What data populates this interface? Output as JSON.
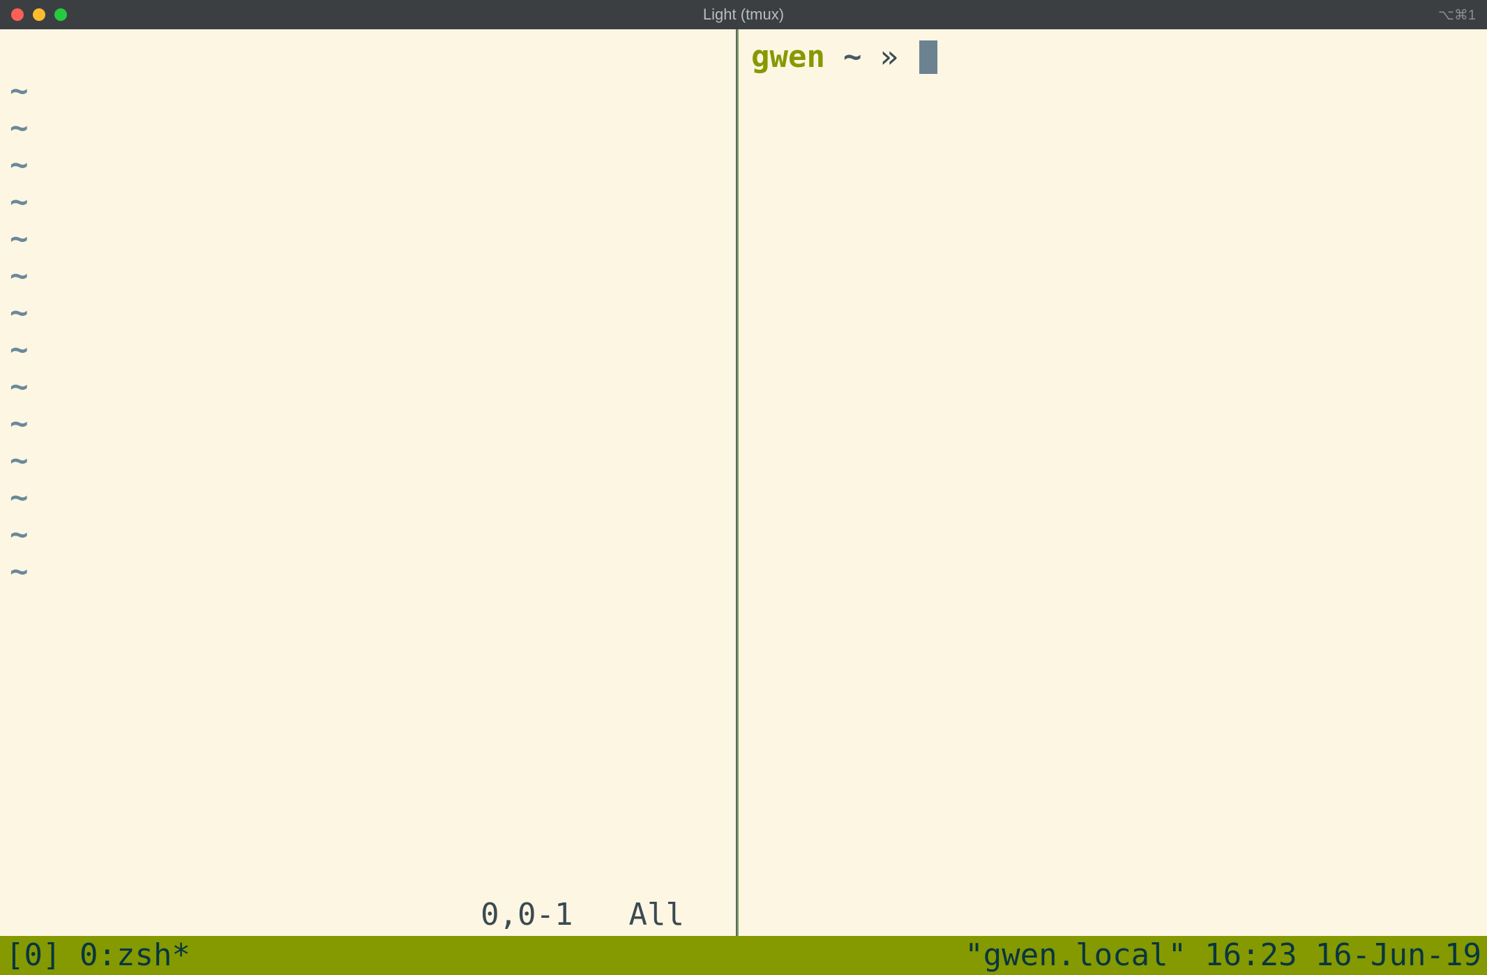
{
  "window": {
    "title": "Light (tmux)",
    "meta": "⌥⌘1"
  },
  "left_pane": {
    "tilde": "~",
    "status_position": "0,0-1",
    "status_scroll": "All"
  },
  "right_pane": {
    "prompt_host": "gwen",
    "prompt_path": "~",
    "prompt_separator": "»"
  },
  "tmux_status": {
    "session": "[0]",
    "window": "0:zsh*",
    "hostname": "\"gwen.local\"",
    "time": "16:23",
    "date": "16-Jun-19"
  }
}
